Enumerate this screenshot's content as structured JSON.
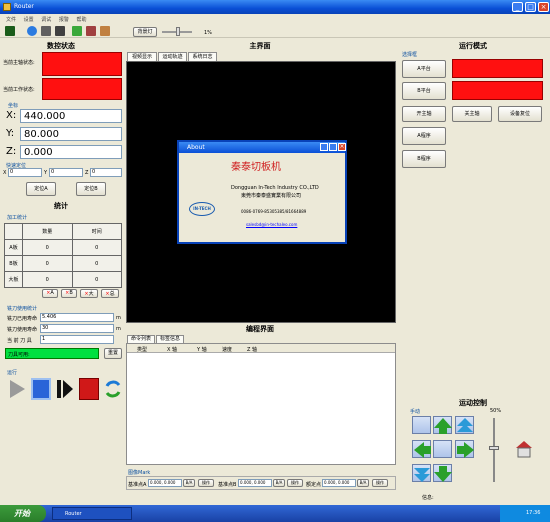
{
  "window": {
    "title": "Router"
  },
  "menu": [
    "文件",
    "设置",
    "调试",
    "报警",
    "帮助"
  ],
  "toolbar": {
    "speed_label": "背景灯",
    "speed_value": "1%"
  },
  "left": {
    "title": "数控状态",
    "main_axis_label": "当前主轴状态:",
    "work_label": "当前工作状态:",
    "coord_group": "坐标",
    "x_label": "X:",
    "x_value": "440.000",
    "y_label": "Y:",
    "y_value": "80.000",
    "z_label": "Z:",
    "z_value": "0.000",
    "fast_pos_title": "快速定位",
    "fx_label": "X",
    "fx_value": "0",
    "fy_label": "Y",
    "fy_value": "0",
    "fz_label": "Z",
    "fz_value": "0",
    "posA": "定位A",
    "posB": "定位B",
    "stats_title": "统计",
    "proc_stats": "加工统计",
    "col_qty": "数量",
    "col_time": "时间",
    "rows": [
      {
        "name": "A板",
        "qty": "0",
        "time": "0"
      },
      {
        "name": "B板",
        "qty": "0",
        "time": "0"
      },
      {
        "name": "大板",
        "qty": "0",
        "time": "0"
      }
    ],
    "clear_btns": [
      "A",
      "B",
      "大",
      "总"
    ],
    "tool_stats": "铣刀使用统计",
    "tool_used_label": "铣刀已用寿命",
    "tool_used": "5.406",
    "tool_used_unit": "m",
    "tool_life_label": "铣刀使用寿命",
    "tool_life": "30",
    "tool_life_unit": "m",
    "tool_cur_label": "当 前 刀 具",
    "tool_cur": "1",
    "tool_ok": "刀具可用:",
    "reset": "重置",
    "run_title": "运行"
  },
  "center": {
    "title": "主界面",
    "tabs": [
      "视频显示",
      "运动轨迹",
      "系统日志"
    ],
    "prog_title": "编程界面",
    "prog_tabs": [
      "命令列表",
      "标签信息"
    ],
    "cols": [
      "类型",
      "X 轴",
      "Y 轴",
      "速度",
      "Z 轴"
    ],
    "status_title": "图像Mark",
    "bottom": [
      {
        "label": "基准点A",
        "value": "0.000, 0.000",
        "unit": "B/A",
        "btn": "操作"
      },
      {
        "label": "基准点B",
        "value": "0.000, 0.000",
        "unit": "B/A",
        "btn": "操作"
      },
      {
        "label": "额定点",
        "value": "0.000, 0.000",
        "unit": "B/A",
        "btn": "操作"
      }
    ]
  },
  "about": {
    "title": "About",
    "cn_name": "秦泰切板机",
    "en_company": "Dongguan In-Tech Industry CO.,LTD",
    "cn_company": "東莞市秦泰盛實業有限公司",
    "phone": "0086-0769-85305385/81664889",
    "email": "salesbd@in-techaleo.com",
    "logo": "IN-TECH"
  },
  "right": {
    "title": "运行模式",
    "mode_group": "选择框",
    "a_plat": "A平台",
    "b_plat": "B平台",
    "spindle_on": "开主轴",
    "spindle_off": "关主轴",
    "reset": "设备复位",
    "a_prog": "A程序",
    "b_prog": "B程序",
    "motion_title": "运动控制",
    "manual": "手动",
    "speed_pct": "50%",
    "info": "信息:"
  },
  "taskbar": {
    "start": "开始",
    "task": "Router",
    "clock": "17:36"
  },
  "colors": {
    "red": "#ff1010",
    "green": "#00e040",
    "titlebar": "#0a4fd6"
  }
}
